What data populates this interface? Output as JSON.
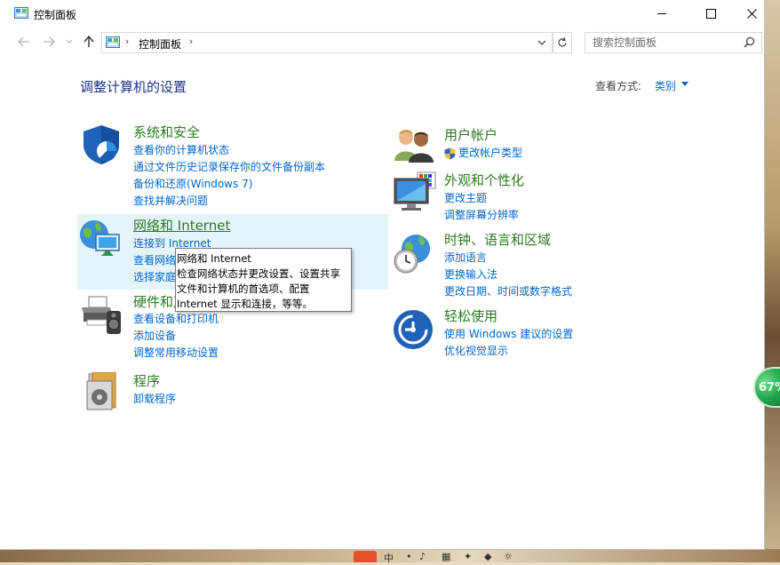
{
  "window": {
    "title": "控制面板"
  },
  "address": {
    "crumb": "控制面板"
  },
  "search": {
    "placeholder": "搜索控制面板"
  },
  "content": {
    "heading": "调整计算机的设置",
    "view_by_label": "查看方式:",
    "view_by_value": "类别"
  },
  "categories": {
    "system": {
      "title": "系统和安全",
      "links": [
        "查看你的计算机状态",
        "通过文件历史记录保存你的文件备份副本",
        "备份和还原(Windows 7)",
        "查找并解决问题"
      ]
    },
    "network": {
      "title": "网络和 Internet",
      "links": [
        "连接到 Internet",
        "查看网络状态和任务",
        "选择家庭组和共享选项"
      ]
    },
    "hardware": {
      "title": "硬件和声音",
      "links": [
        "查看设备和打印机",
        "添加设备",
        "调整常用移动设置"
      ]
    },
    "programs": {
      "title": "程序",
      "links": [
        "卸载程序"
      ]
    },
    "accounts": {
      "title": "用户帐户",
      "links": [
        "更改帐户类型"
      ]
    },
    "appearance": {
      "title": "外观和个性化",
      "links": [
        "更改主题",
        "调整屏幕分辨率"
      ]
    },
    "clock": {
      "title": "时钟、语言和区域",
      "links": [
        "添加语言",
        "更换输入法",
        "更改日期、时间或数字格式"
      ]
    },
    "ease": {
      "title": "轻松使用",
      "links": [
        "使用 Windows 建议的设置",
        "优化视觉显示"
      ]
    }
  },
  "tooltip": {
    "lines": [
      "网络和 Internet",
      "检查网络状态并更改设置、设置共享",
      "文件和计算机的首选项、配置",
      "Internet 显示和连接，等等。"
    ]
  },
  "badge": {
    "value": "67%"
  },
  "taskbar": {
    "ime": "中"
  },
  "colors": {
    "title_green": "#2a7b1f",
    "link_blue": "#0066cc",
    "hover_bg": "#e5f3fb",
    "heading_blue": "#1e3287"
  }
}
